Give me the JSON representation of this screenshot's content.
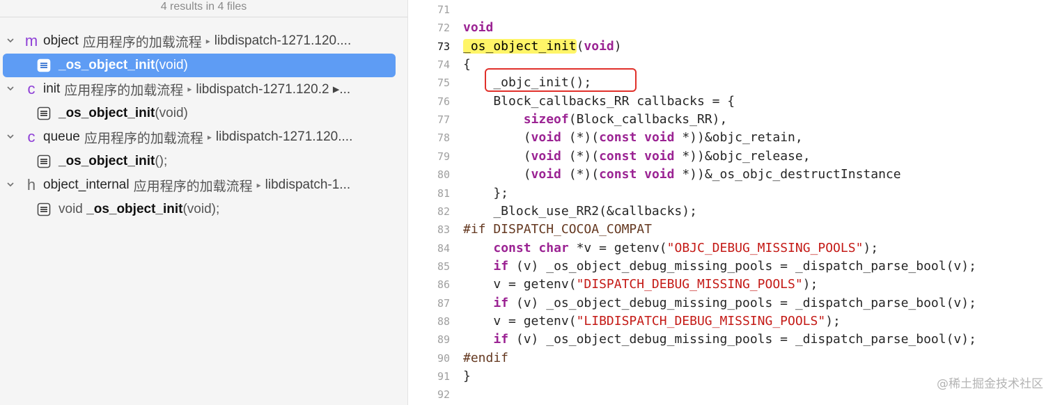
{
  "find_navigator": {
    "summary": "4 results in 4 files",
    "groups": [
      {
        "type_letter": "m",
        "file": "object",
        "dir": "应用程序的加载流程",
        "path": "libdispatch-1271.120....",
        "matches": [
          {
            "pre": "",
            "hit": "_os_object_init",
            "post": "(void)",
            "selected": true
          }
        ]
      },
      {
        "type_letter": "c",
        "file": "init",
        "dir": "应用程序的加载流程",
        "path": "libdispatch-1271.120.2 ▸...",
        "matches": [
          {
            "pre": "",
            "hit": "_os_object_init",
            "post": "(void)",
            "selected": false
          }
        ]
      },
      {
        "type_letter": "c",
        "file": "queue",
        "dir": "应用程序的加载流程",
        "path": "libdispatch-1271.120....",
        "matches": [
          {
            "pre": "",
            "hit": "_os_object_init",
            "post": "();",
            "selected": false
          }
        ]
      },
      {
        "type_letter": "h",
        "file": "object_internal",
        "dir": "应用程序的加载流程",
        "path": "libdispatch-1...",
        "matches": [
          {
            "pre": "void ",
            "hit": "_os_object_init",
            "post": "(void);",
            "selected": false
          }
        ]
      }
    ]
  },
  "editor": {
    "current_line": 73,
    "lines": [
      {
        "n": "71",
        "segs": []
      },
      {
        "n": "72",
        "segs": [
          {
            "t": "void",
            "c": "kw"
          }
        ]
      },
      {
        "n": "73",
        "segs": [
          {
            "t": "_os_object_init",
            "c": "hl"
          },
          {
            "t": "(",
            "c": "code"
          },
          {
            "t": "void",
            "c": "kw"
          },
          {
            "t": ")",
            "c": "code"
          }
        ]
      },
      {
        "n": "74",
        "segs": [
          {
            "t": "{",
            "c": "code"
          }
        ]
      },
      {
        "n": "75",
        "segs": [
          {
            "t": "    _objc_init();",
            "c": "code"
          }
        ]
      },
      {
        "n": "76",
        "segs": [
          {
            "t": "    Block_callbacks_RR callbacks = {",
            "c": "code"
          }
        ]
      },
      {
        "n": "77",
        "segs": [
          {
            "t": "        ",
            "c": "code"
          },
          {
            "t": "sizeof",
            "c": "kw"
          },
          {
            "t": "(Block_callbacks_RR),",
            "c": "code"
          }
        ]
      },
      {
        "n": "78",
        "segs": [
          {
            "t": "        (",
            "c": "code"
          },
          {
            "t": "void",
            "c": "kw"
          },
          {
            "t": " (*)(",
            "c": "code"
          },
          {
            "t": "const",
            "c": "kw"
          },
          {
            "t": " ",
            "c": "code"
          },
          {
            "t": "void",
            "c": "kw"
          },
          {
            "t": " *))&objc_retain,",
            "c": "code"
          }
        ]
      },
      {
        "n": "79",
        "segs": [
          {
            "t": "        (",
            "c": "code"
          },
          {
            "t": "void",
            "c": "kw"
          },
          {
            "t": " (*)(",
            "c": "code"
          },
          {
            "t": "const",
            "c": "kw"
          },
          {
            "t": " ",
            "c": "code"
          },
          {
            "t": "void",
            "c": "kw"
          },
          {
            "t": " *))&objc_release,",
            "c": "code"
          }
        ]
      },
      {
        "n": "80",
        "segs": [
          {
            "t": "        (",
            "c": "code"
          },
          {
            "t": "void",
            "c": "kw"
          },
          {
            "t": " (*)(",
            "c": "code"
          },
          {
            "t": "const",
            "c": "kw"
          },
          {
            "t": " ",
            "c": "code"
          },
          {
            "t": "void",
            "c": "kw"
          },
          {
            "t": " *))&_os_objc_destructInstance",
            "c": "code"
          }
        ]
      },
      {
        "n": "81",
        "segs": [
          {
            "t": "    };",
            "c": "code"
          }
        ]
      },
      {
        "n": "82",
        "segs": [
          {
            "t": "    _Block_use_RR2(&callbacks);",
            "c": "code"
          }
        ]
      },
      {
        "n": "83",
        "segs": [
          {
            "t": "#if DISPATCH_COCOA_COMPAT",
            "c": "pp"
          }
        ]
      },
      {
        "n": "84",
        "segs": [
          {
            "t": "    ",
            "c": "code"
          },
          {
            "t": "const",
            "c": "kw"
          },
          {
            "t": " ",
            "c": "code"
          },
          {
            "t": "char",
            "c": "kw"
          },
          {
            "t": " *v = getenv(",
            "c": "code"
          },
          {
            "t": "\"OBJC_DEBUG_MISSING_POOLS\"",
            "c": "str"
          },
          {
            "t": ");",
            "c": "code"
          }
        ]
      },
      {
        "n": "85",
        "segs": [
          {
            "t": "    ",
            "c": "code"
          },
          {
            "t": "if",
            "c": "kw"
          },
          {
            "t": " (v) _os_object_debug_missing_pools = _dispatch_parse_bool(v);",
            "c": "code"
          }
        ]
      },
      {
        "n": "86",
        "segs": [
          {
            "t": "    v = getenv(",
            "c": "code"
          },
          {
            "t": "\"DISPATCH_DEBUG_MISSING_POOLS\"",
            "c": "str"
          },
          {
            "t": ");",
            "c": "code"
          }
        ]
      },
      {
        "n": "87",
        "segs": [
          {
            "t": "    ",
            "c": "code"
          },
          {
            "t": "if",
            "c": "kw"
          },
          {
            "t": " (v) _os_object_debug_missing_pools = _dispatch_parse_bool(v);",
            "c": "code"
          }
        ]
      },
      {
        "n": "88",
        "segs": [
          {
            "t": "    v = getenv(",
            "c": "code"
          },
          {
            "t": "\"LIBDISPATCH_DEBUG_MISSING_POOLS\"",
            "c": "str"
          },
          {
            "t": ");",
            "c": "code"
          }
        ]
      },
      {
        "n": "89",
        "segs": [
          {
            "t": "    ",
            "c": "code"
          },
          {
            "t": "if",
            "c": "kw"
          },
          {
            "t": " (v) _os_object_debug_missing_pools = _dispatch_parse_bool(v);",
            "c": "code"
          }
        ]
      },
      {
        "n": "90",
        "segs": [
          {
            "t": "#endif",
            "c": "pp"
          }
        ]
      },
      {
        "n": "91",
        "segs": [
          {
            "t": "}",
            "c": "code"
          }
        ]
      },
      {
        "n": "92",
        "segs": []
      }
    ]
  },
  "watermark": "@稀土掘金技术社区",
  "colors": {
    "selection": "#5e9cf4",
    "keyword": "#9b2393",
    "string": "#c41a16",
    "highlight": "#fff568",
    "annotation_box": "#e0302a",
    "filetype_letter": "#8e3fd6"
  },
  "icons": [
    "chevron-down-icon",
    "file-type-m-icon",
    "file-type-c-icon",
    "file-type-h-icon",
    "code-line-match-icon"
  ]
}
